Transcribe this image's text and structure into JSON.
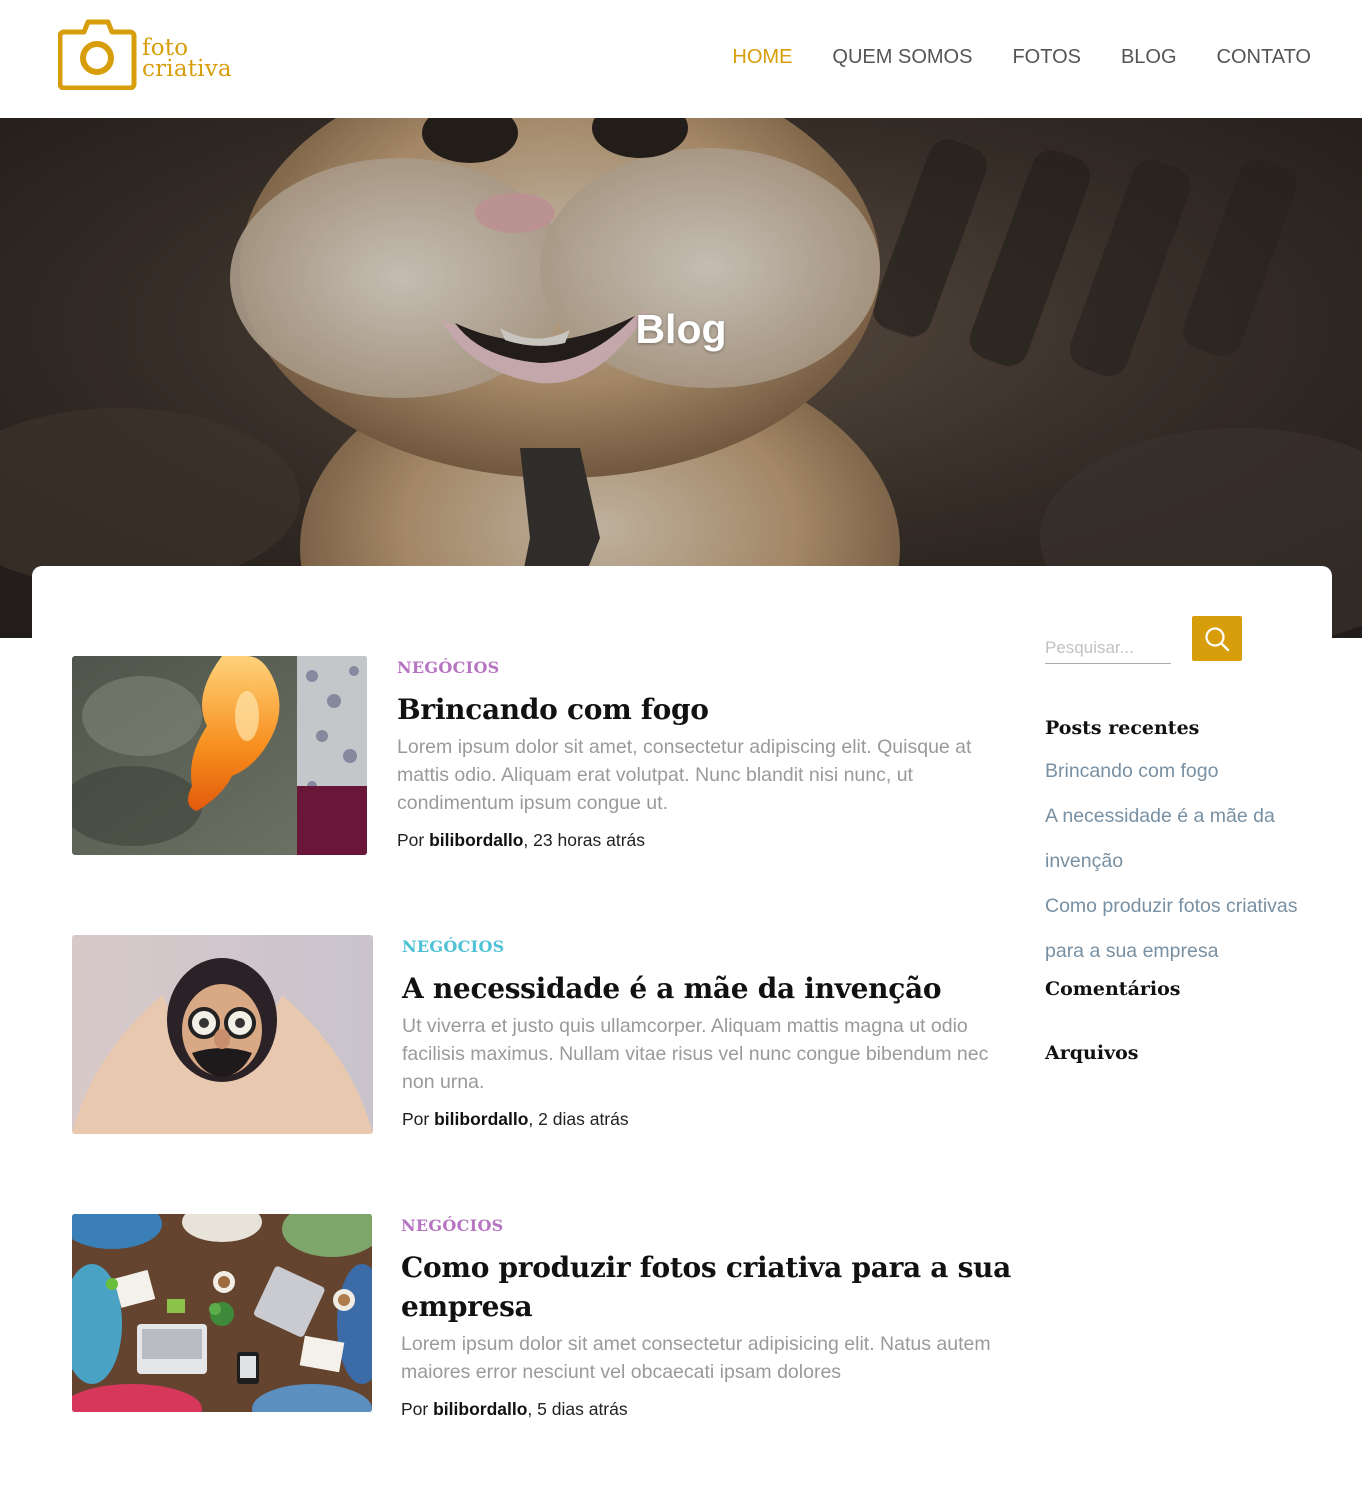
{
  "brand": {
    "line1": "foto",
    "line2": "criativa",
    "logo_icon": "camera-icon",
    "accent_color": "#d89d0a"
  },
  "nav": {
    "items": [
      {
        "label": "HOME",
        "active": true
      },
      {
        "label": "QUEM SOMOS",
        "active": false
      },
      {
        "label": "FOTOS",
        "active": false
      },
      {
        "label": "BLOG",
        "active": false
      },
      {
        "label": "CONTATO",
        "active": false
      }
    ]
  },
  "hero": {
    "title": "Blog"
  },
  "posts": [
    {
      "category": "NEGÓCIOS",
      "category_color": "#b774c2",
      "title": "Brincando com fogo",
      "excerpt": "Lorem ipsum dolor sit amet, consectetur adipiscing elit. Quisque at mattis odio. Aliquam erat volutpat. Nunc blandit nisi nunc, ut condimentum ipsum congue ut.",
      "by_prefix": "Por ",
      "author": "bilibordallo",
      "time": ", 23 horas atrás"
    },
    {
      "category": "NEGÓCIOS",
      "category_color": "#4ec1d6",
      "title": "A necessidade é a mãe da invenção",
      "excerpt": "Ut viverra et justo quis ullamcorper. Aliquam mattis magna ut odio facilisis maximus. Nullam vitae risus vel nunc congue bibendum nec non urna.",
      "by_prefix": "Por ",
      "author": "bilibordallo",
      "time": ", 2 dias atrás"
    },
    {
      "category": "NEGÓCIOS",
      "category_color": "#b774c2",
      "title": "Como produzir fotos criativa para a sua empresa",
      "excerpt": "Lorem ipsum dolor sit amet consectetur adipisicing elit. Natus autem maiores error nesciunt vel obcaecati ipsam dolores",
      "by_prefix": "Por ",
      "author": "bilibordallo",
      "time": ", 5 dias atrás"
    }
  ],
  "sidebar": {
    "search_placeholder": "Pesquisar...",
    "search_icon": "search-icon",
    "recent_heading": "Posts recentes",
    "recent_posts": [
      "Brincando com fogo",
      "A necessidade é a mãe da",
      "invenção",
      "Como produzir fotos criativas",
      "para a sua empresa"
    ],
    "comments_heading": "Comentários",
    "archives_heading": "Arquivos"
  }
}
